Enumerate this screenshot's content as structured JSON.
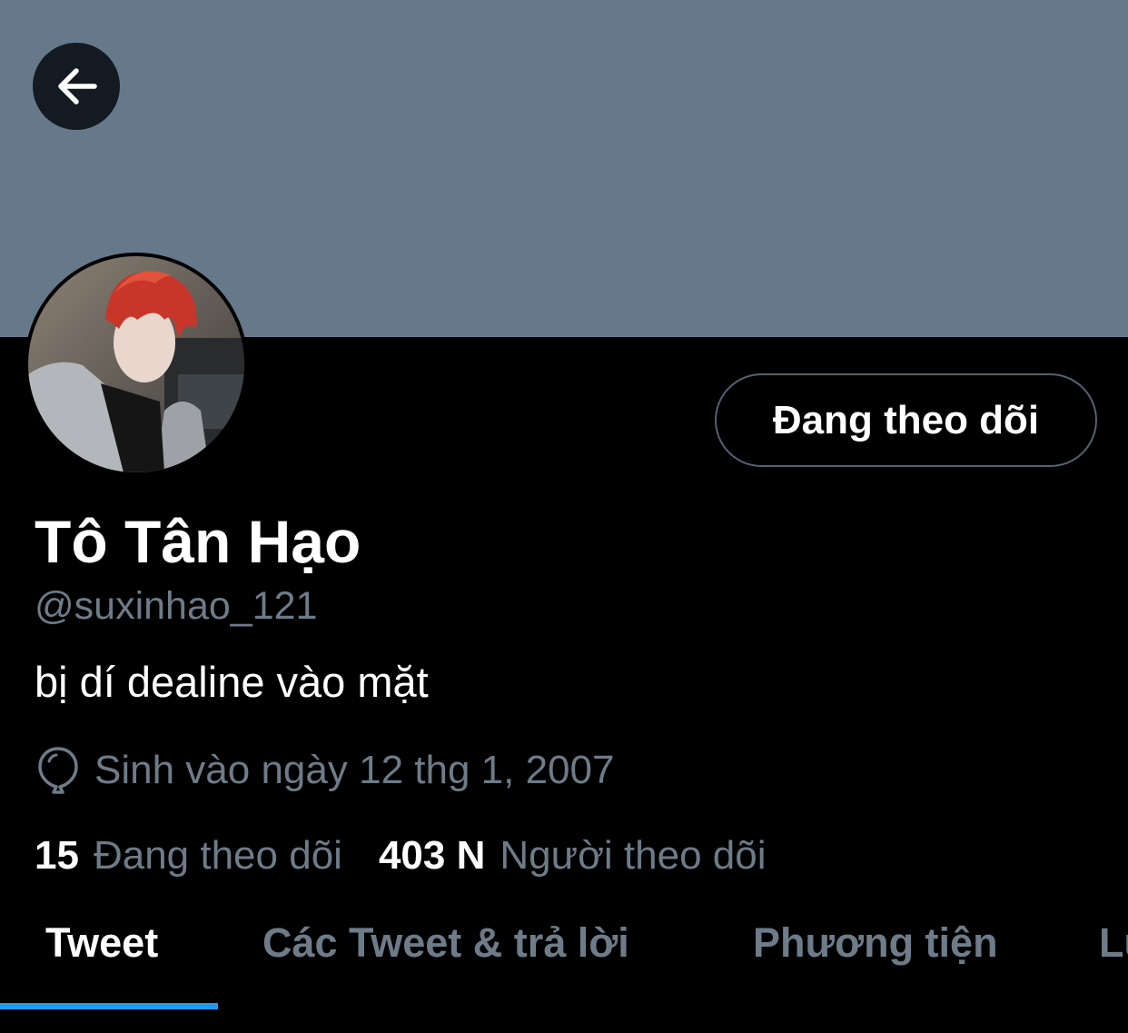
{
  "profile": {
    "display_name": "Tô Tân Hạo",
    "handle": "@suxinhao_121",
    "bio": "bị dí dealine vào mặt",
    "birth": "Sinh vào ngày 12 thg 1, 2007",
    "following_count": "15",
    "following_label": "Đang theo dõi",
    "followers_count": "403 N",
    "followers_label": "Người theo dõi"
  },
  "actions": {
    "follow_button_label": "Đang theo dõi"
  },
  "tabs": [
    {
      "label": "Tweet",
      "active": true
    },
    {
      "label": "Các Tweet & trả lời",
      "active": false
    },
    {
      "label": "Phương tiện",
      "active": false
    },
    {
      "label": "Lư",
      "active": false
    }
  ],
  "icons": {
    "back": "arrow-left-icon",
    "birthday": "balloon-icon"
  },
  "colors": {
    "banner": "#66798a",
    "background": "#000000",
    "secondary_text": "#6e7b88",
    "accent": "#1d9bf0"
  }
}
